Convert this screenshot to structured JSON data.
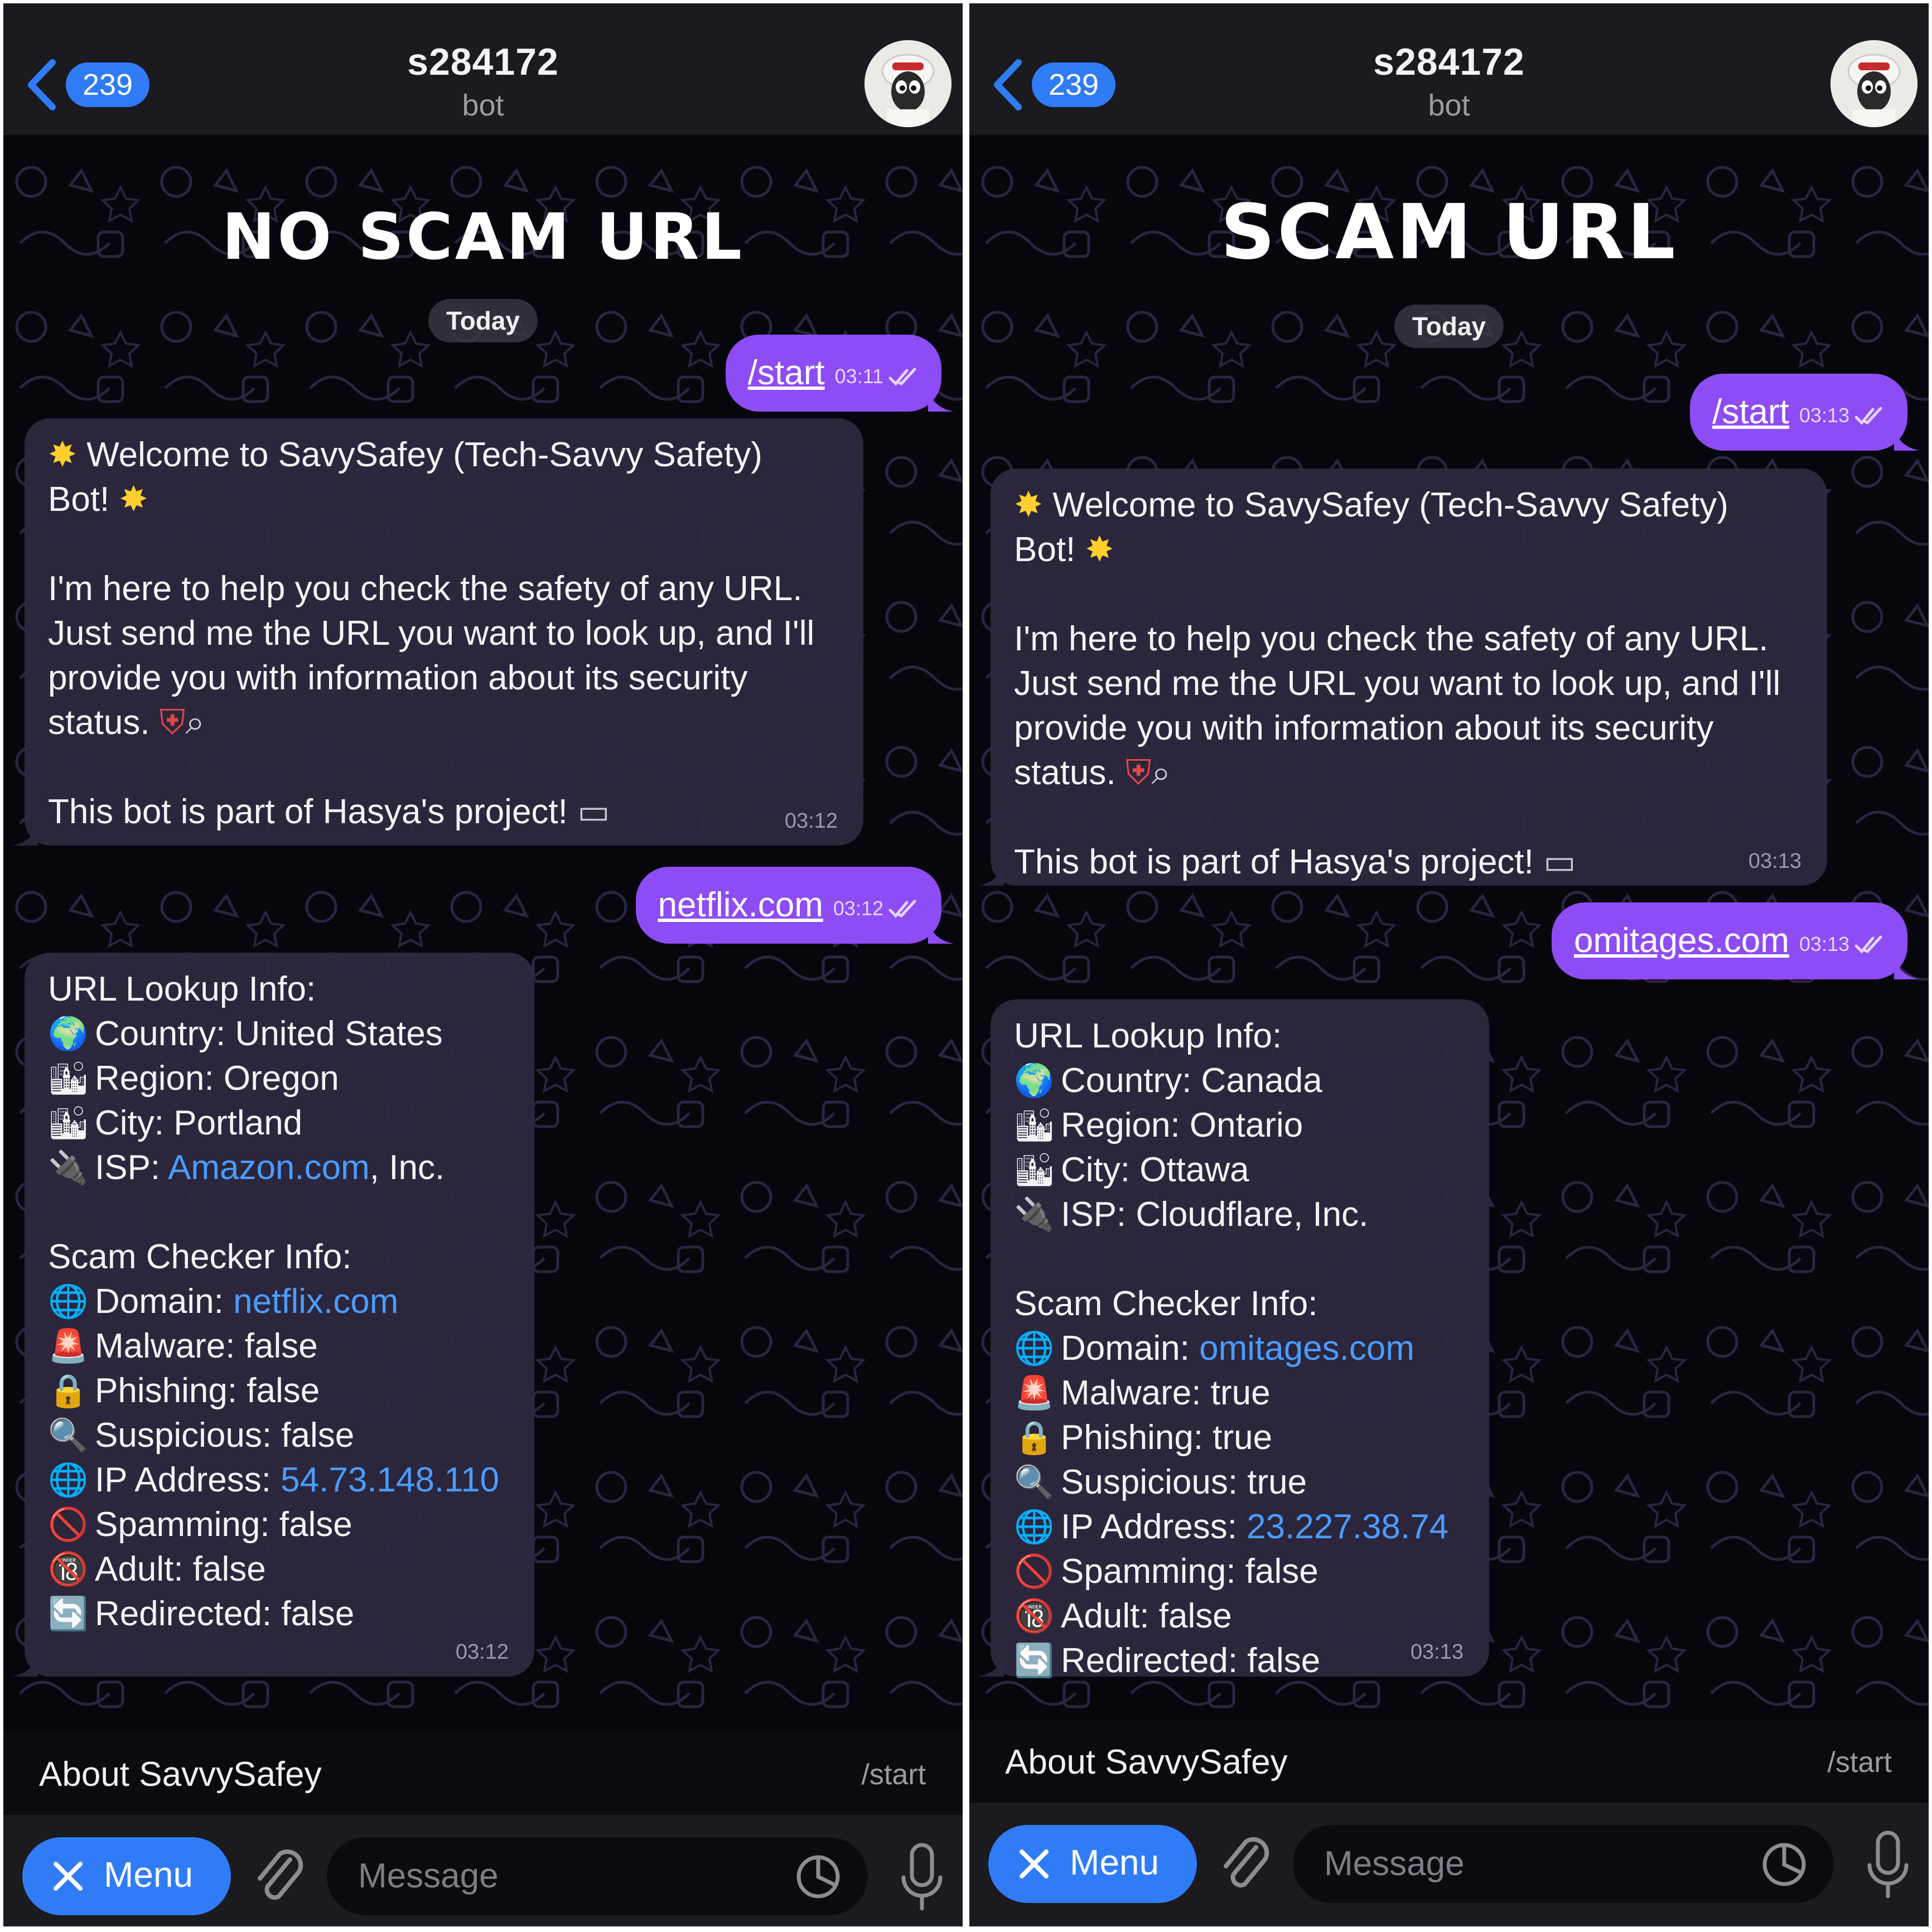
{
  "panels": [
    {
      "header": {
        "back_count": "239",
        "title": "s284172",
        "subtitle": "bot"
      },
      "overlay_title": "NO SCAM URL",
      "date_separator": "Today",
      "start_message": {
        "text": "/start",
        "time": "03:11"
      },
      "welcome": {
        "line1": "Welcome to SavySafey (Tech-Savvy Safety)",
        "line2": "Bot!",
        "body": "I'm here to help you check the safety of any URL.\nJust send me the URL you want to look up, and I'll\nprovide you with information about its security\nstatus.",
        "footer": "This bot is part of Hasya's project!",
        "time": "03:12"
      },
      "url_message": {
        "text": "netflix.com",
        "time": "03:12"
      },
      "lookup": {
        "heading": "URL Lookup Info:",
        "country": "Country: United States",
        "region": "Region: Oregon",
        "city": "City: Portland",
        "isp_prefix": "ISP: ",
        "isp_link": "Amazon.com",
        "isp_suffix": ", Inc.",
        "scam_heading": "Scam Checker Info:",
        "domain_prefix": "Domain: ",
        "domain_link": "netflix.com",
        "malware": "Malware: false",
        "phishing": "Phishing: false",
        "suspicious": "Suspicious: false",
        "ip_prefix": "IP Address: ",
        "ip_link": "54.73.148.110",
        "spamming": "Spamming: false",
        "adult": "Adult: false",
        "redirected": "Redirected: false",
        "time": "03:12"
      },
      "about": {
        "label": "About SavvySafey",
        "command": "/start"
      },
      "composer": {
        "menu_label": "Menu",
        "placeholder": "Message"
      }
    },
    {
      "header": {
        "back_count": "239",
        "title": "s284172",
        "subtitle": "bot"
      },
      "overlay_title": "SCAM URL",
      "date_separator": "Today",
      "start_message": {
        "text": "/start",
        "time": "03:13"
      },
      "welcome": {
        "line1": "Welcome to SavySafey (Tech-Savvy Safety)",
        "line2": "Bot!",
        "body": "I'm here to help you check the safety of any URL.\nJust send me the URL you want to look up, and I'll\nprovide you with information about its security\nstatus.",
        "footer": "This bot is part of Hasya's project!",
        "time": "03:13"
      },
      "url_message": {
        "text": "omitages.com",
        "time": "03:13"
      },
      "lookup": {
        "heading": "URL Lookup Info:",
        "country": "Country: Canada",
        "region": "Region: Ontario",
        "city": "City: Ottawa",
        "isp_prefix": "ISP: Cloudflare, Inc.",
        "isp_link": "",
        "isp_suffix": "",
        "scam_heading": "Scam Checker Info:",
        "domain_prefix": "Domain: ",
        "domain_link": "omitages.com",
        "malware": "Malware: true",
        "phishing": "Phishing: true",
        "suspicious": "Suspicious: true",
        "ip_prefix": "IP Address: ",
        "ip_link": "23.227.38.74",
        "spamming": "Spamming: false",
        "adult": "Adult: false",
        "redirected": "Redirected: false",
        "time": "03:13"
      },
      "about": {
        "label": "About SavvySafey",
        "command": "/start"
      },
      "composer": {
        "menu_label": "Menu",
        "placeholder": "Message"
      }
    }
  ],
  "icons": {
    "sparkle": "sparkle-icon",
    "shield": "shield-icon",
    "magnifier": "magnifier-icon",
    "laptop": "laptop-icon",
    "globe": "globe-icon",
    "cityscape": "cityscape-icon",
    "plug": "plug-icon",
    "web": "web-icon",
    "siren": "siren-icon",
    "lock": "lock-icon",
    "no-entry": "no-entry-icon",
    "adult": "adult-only-icon",
    "refresh": "refresh-icon"
  },
  "colors": {
    "outgoing_bubble": "#8e4cf4",
    "incoming_bubble": "#2e2840",
    "accent": "#2f7cf6",
    "link": "#4a9cff",
    "header": "#1b1a1f",
    "chat_background": "#07060c"
  }
}
